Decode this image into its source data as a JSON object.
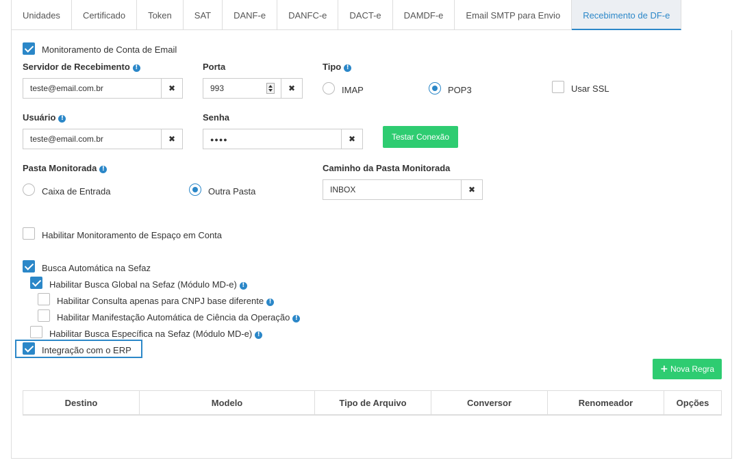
{
  "tabs": [
    "Unidades",
    "Certificado",
    "Token",
    "SAT",
    "DANF-e",
    "DANFC-e",
    "DACT-e",
    "DAMDF-e",
    "Email SMTP para Envio",
    "Recebimento de DF-e"
  ],
  "active_tab": "Recebimento de DF-e",
  "colors": {
    "accent": "#2b87c8",
    "success": "#2ecc71"
  },
  "icons": {
    "info": "info-circle-icon",
    "clear": "times-icon",
    "plus": "plus-icon",
    "check": "check-icon"
  },
  "email_monitoring": {
    "label": "Monitoramento de Conta de Email",
    "checked": true
  },
  "server": {
    "label": "Servidor de Recebimento",
    "value": "teste@email.com.br"
  },
  "port": {
    "label": "Porta",
    "value": "993"
  },
  "type": {
    "label": "Tipo",
    "options": [
      "IMAP",
      "POP3"
    ],
    "selected": "POP3"
  },
  "ssl": {
    "label": "Usar SSL",
    "checked": false
  },
  "user": {
    "label": "Usuário",
    "value": "teste@email.com.br"
  },
  "password": {
    "label": "Senha",
    "value": "●●●●"
  },
  "test_button": "Testar Conexão",
  "folder": {
    "label": "Pasta Monitorada",
    "options": [
      "Caixa de Entrada",
      "Outra Pasta"
    ],
    "selected": "Outra Pasta"
  },
  "folder_path": {
    "label": "Caminho da Pasta Monitorada",
    "value": "INBOX"
  },
  "space_monitoring": {
    "label": "Habilitar Monitoramento de Espaço em Conta",
    "checked": false
  },
  "auto_search": {
    "label": "Busca Automática na Sefaz",
    "checked": true
  },
  "global_search": {
    "label": "Habilitar Busca Global na Sefaz (Módulo MD-e)",
    "checked": true
  },
  "cnpj_query": {
    "label": "Habilitar Consulta apenas para CNPJ base diferente",
    "checked": false
  },
  "auto_manifest": {
    "label": "Habilitar Manifestação Automática de Ciência da Operação",
    "checked": false
  },
  "specific_search": {
    "label": "Habilitar Busca Específica na Sefaz (Módulo MD-e)",
    "checked": false
  },
  "erp_integration": {
    "label": "Integração com o ERP",
    "checked": true
  },
  "new_rule_button": "Nova Regra",
  "table": {
    "columns": [
      "Destino",
      "Modelo",
      "Tipo de Arquivo",
      "Conversor",
      "Renomeador",
      "Opções"
    ]
  }
}
